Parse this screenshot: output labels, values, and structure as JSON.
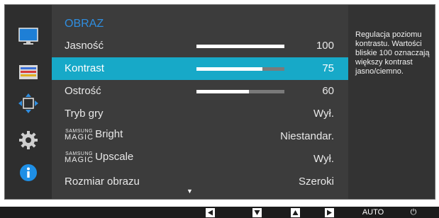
{
  "menu": {
    "title": "OBRAZ",
    "items": [
      {
        "label": "Jasność",
        "value": "100",
        "level": 1.0,
        "selected": false
      },
      {
        "label": "Kontrast",
        "value": "75",
        "level": 0.75,
        "selected": true
      },
      {
        "label": "Ostrość",
        "value": "60",
        "level": 0.6,
        "selected": false
      },
      {
        "label": "Tryb gry",
        "value": "Wył.",
        "selected": false
      },
      {
        "brand_top": "SAMSUNG",
        "brand_mid": "MAGIC",
        "label": "Bright",
        "value": "Niestandar.",
        "selected": false
      },
      {
        "brand_top": "SAMSUNG",
        "brand_mid": "MAGIC",
        "label": "Upscale",
        "value": "Wył.",
        "selected": false
      },
      {
        "label": "Rozmiar obrazu",
        "value": "Szeroki",
        "selected": false
      }
    ]
  },
  "help_text": "Regulacja poziomu kontrastu. Wartości bliskie 100 oznaczają większy kontrast jasno/ciemno.",
  "sidebar_icons": [
    "monitor-icon",
    "color-bars-icon",
    "size-position-icon",
    "gear-icon",
    "info-icon"
  ],
  "bottom_keys": [
    {
      "icon": "left-arrow-icon"
    },
    {
      "icon": "down-arrow-icon"
    },
    {
      "icon": "up-arrow-icon"
    },
    {
      "icon": "right-arrow-icon"
    },
    {
      "label": "AUTO"
    },
    {
      "icon": "power-icon",
      "glyph": "⏻"
    }
  ],
  "colors": {
    "accent": "#17a9c8",
    "title": "#2f8ee0",
    "menu_bg": "#3c3c3c",
    "frame_bg": "#2e2e2e",
    "bar_track": "#7a7a7a"
  }
}
